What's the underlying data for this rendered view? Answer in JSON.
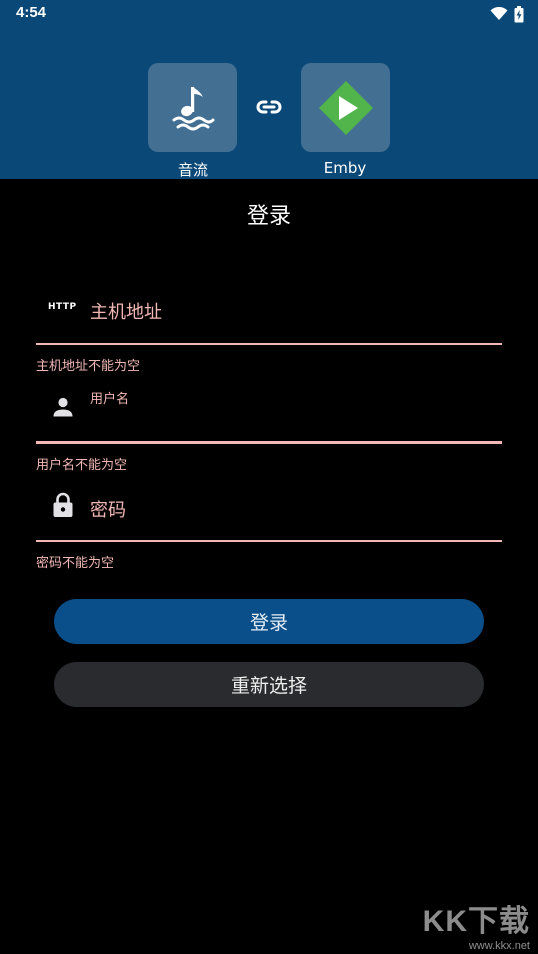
{
  "status_bar": {
    "time": "4:54",
    "icons": [
      "wifi-icon",
      "battery-charging-icon"
    ]
  },
  "header": {
    "left_app": {
      "name": "音流",
      "icon": "music-note-waves-icon"
    },
    "link_icon": "link-icon",
    "right_app": {
      "name": "Emby",
      "icon": "emby-play-icon",
      "brand_color": "#52b54b"
    }
  },
  "login": {
    "title": "登录",
    "host": {
      "icon_text": "HTTP",
      "placeholder": "主机地址",
      "error": "主机地址不能为空"
    },
    "username": {
      "icon": "person-icon",
      "label": "用户名",
      "value": "",
      "error": "用户名不能为空"
    },
    "password": {
      "icon": "lock-icon",
      "placeholder": "密码",
      "error": "密码不能为空"
    },
    "login_button": "登录",
    "reselect_button": "重新选择"
  },
  "watermark": {
    "brand": "KK下载",
    "url": "www.kkx.net"
  },
  "colors": {
    "header_bg": "#0a4877",
    "tile_bg": "#426f92",
    "error": "#f2b8b5",
    "primary_button": "#0a4f8a",
    "secondary_button": "#2a2b2f"
  }
}
